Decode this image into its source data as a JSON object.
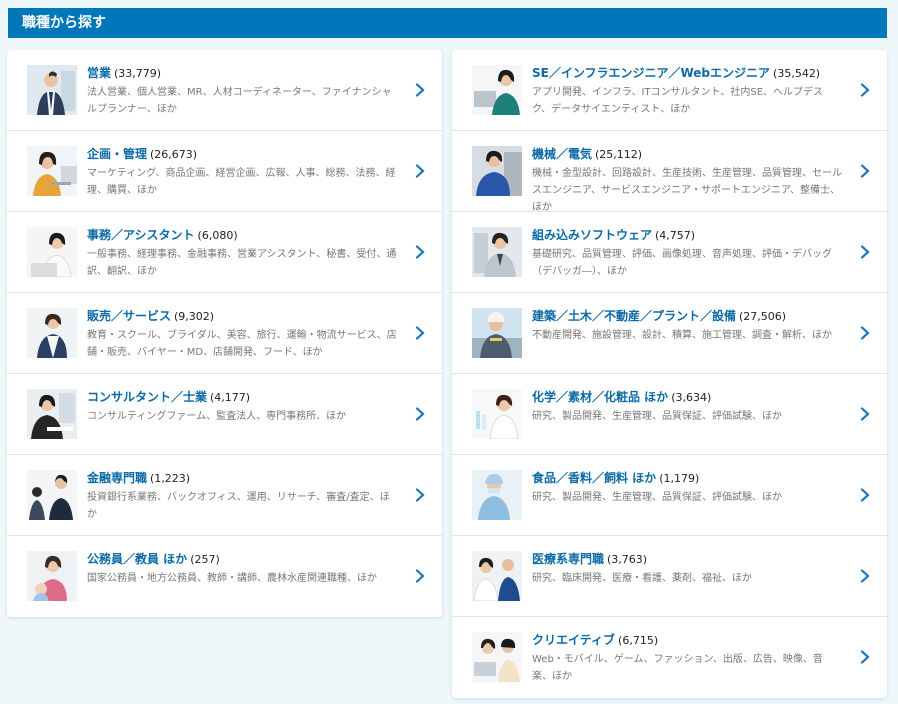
{
  "header": {
    "title": "職種から探す"
  },
  "left_items": [
    {
      "title": "営業",
      "count": "(33,779)",
      "desc": "法人営業、個人営業、MR、人材コーディネーター、ファイナンシャルプランナー、ほか",
      "icon": "sales-person-photo"
    },
    {
      "title": "企画・管理",
      "count": "(26,673)",
      "desc": "マーケティング、商品企画、経営企画、広報、人事、総務、法務、経理、購買、ほか",
      "icon": "planning-person-photo"
    },
    {
      "title": "事務／アシスタント",
      "count": "(6,080)",
      "desc": "一般事務、経理事務、金融事務、営業アシスタント、秘書、受付、通訳、翻訳、ほか",
      "icon": "office-person-photo"
    },
    {
      "title": "販売／サービス",
      "count": "(9,302)",
      "desc": "教育・スクール、ブライダル、美容、旅行、運輸・物流サービス、店舗・販売、バイヤー・MD、店舗開発、フード、ほか",
      "icon": "service-person-photo"
    },
    {
      "title": "コンサルタント／士業",
      "count": "(4,177)",
      "desc": "コンサルティングファーム、監査法人、専門事務所、ほか",
      "icon": "consultant-person-photo"
    },
    {
      "title": "金融専門職",
      "count": "(1,223)",
      "desc": "投資銀行系業務、バックオフィス、運用、リサーチ、審査/査定、ほか",
      "icon": "finance-person-photo"
    },
    {
      "title": "公務員／教員 ほか",
      "count": "(257)",
      "desc": "国家公務員・地方公務員、教師・講師、農林水産関連職種、ほか",
      "icon": "public-servant-photo"
    }
  ],
  "right_items": [
    {
      "title": "SE／インフラエンジニア／Webエンジニア",
      "count": "(35,542)",
      "desc": "アプリ開発、インフラ、ITコンサルタント、社内SE、ヘルプデスク、データサイエンティスト、ほか",
      "icon": "engineer-person-photo"
    },
    {
      "title": "機械／電気",
      "count": "(25,112)",
      "desc": "機械・金型設計、回路設計、生産技術、生産管理、品質管理、セールスエンジニア、サービスエンジニア・サポートエンジニア、整備士、ほか",
      "icon": "mechanic-person-photo"
    },
    {
      "title": "組み込みソフトウェア",
      "count": "(4,757)",
      "desc": "基礎研究、品質管理、評価、画像処理、音声処理、評価・デバッグ（デバッガ―）、ほか",
      "icon": "embedded-person-photo"
    },
    {
      "title": "建築／土木／不動産／プラント／設備",
      "count": "(27,506)",
      "desc": "不動産開発、施設管理、設計、積算、施工管理、調査・解析、ほか",
      "icon": "construction-person-photo"
    },
    {
      "title": "化学／素材／化粧品 ほか",
      "count": "(3,634)",
      "desc": "研究、製品開発、生産管理、品質保証、評価試験、ほか",
      "icon": "chemistry-person-photo"
    },
    {
      "title": "食品／香料／飼料 ほか",
      "count": "(1,179)",
      "desc": "研究、製品開発、生産管理、品質保証、評価試験、ほか",
      "icon": "food-person-photo"
    },
    {
      "title": "医療系専門職",
      "count": "(3,763)",
      "desc": "研究、臨床開発、医療・看護、薬剤、福祉、ほか",
      "icon": "medical-person-photo"
    },
    {
      "title": "クリエイティブ",
      "count": "(6,715)",
      "desc": "Web・モバイル、ゲーム、ファッション、出版、広告、映像、音楽、ほか",
      "icon": "creative-person-photo"
    }
  ],
  "colors": {
    "accent": "#0077bb",
    "title": "#0b6aa8",
    "chevron": "#1a73b8"
  }
}
